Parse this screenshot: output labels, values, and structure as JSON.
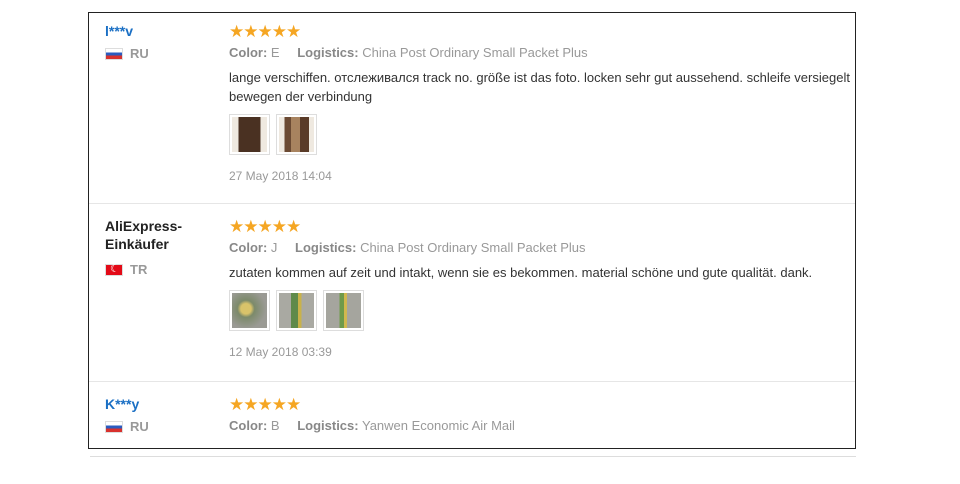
{
  "reviews": [
    {
      "user": "l***v",
      "country": "RU",
      "stars": "★★★★★",
      "color_label": "Color:",
      "color_value": "E",
      "logistics_label": "Logistics:",
      "logistics_value": "China Post Ordinary Small Packet Plus",
      "text_line1": "lange verschiffen. отслеживался track no. größe ist das foto. locken sehr gut aussehend. schleife versiegelt",
      "text_line2": "bewegen der verbindung",
      "date": "27 May 2018 14:04"
    },
    {
      "user_line1": "AliExpress-",
      "user_line2": "Einkäufer",
      "country": "TR",
      "stars": "★★★★★",
      "color_label": "Color:",
      "color_value": "J",
      "logistics_label": "Logistics:",
      "logistics_value": "China Post Ordinary Small Packet Plus",
      "text_line1": "zutaten kommen auf zeit und intakt, wenn sie es bekommen. material schöne und gute qualität. dank.",
      "date": "12 May 2018 03:39"
    },
    {
      "user": "K***y",
      "country": "RU",
      "stars": "★★★★★",
      "color_label": "Color:",
      "color_value": "B",
      "logistics_label": "Logistics:",
      "logistics_value": "Yanwen Economic Air Mail"
    }
  ]
}
